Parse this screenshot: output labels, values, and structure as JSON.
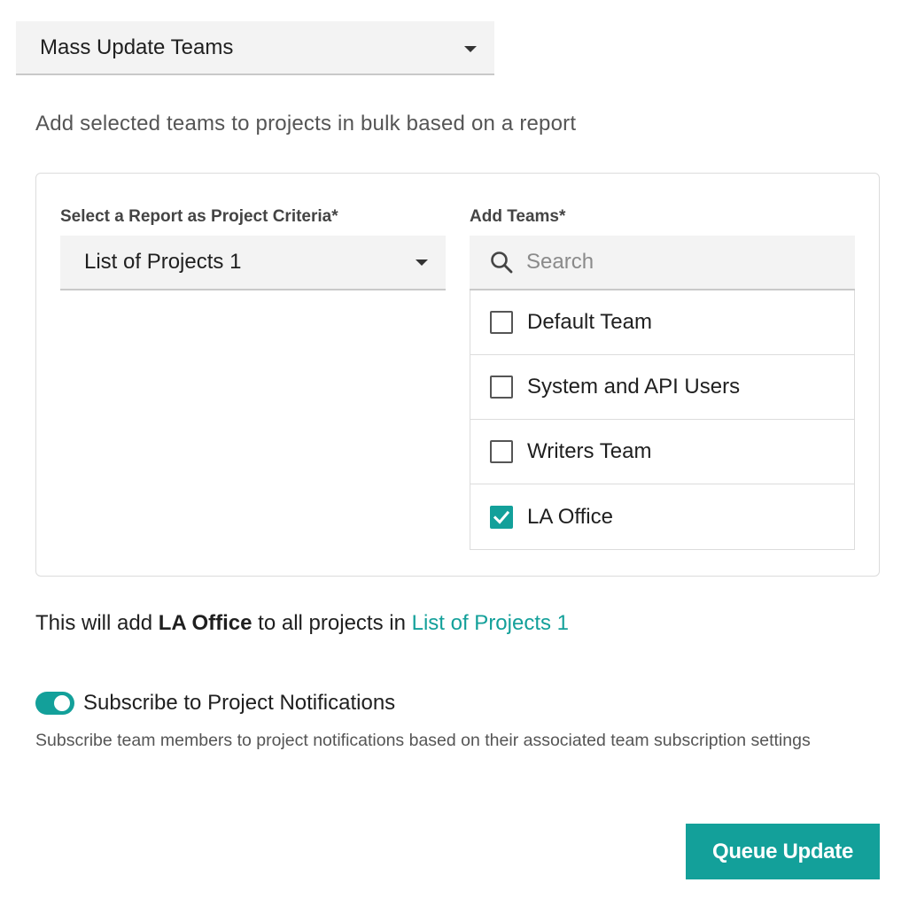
{
  "mode_select": {
    "selected": "Mass Update Teams",
    "icon": "chevron-down-icon"
  },
  "description": "Add selected teams to projects in bulk based on a report",
  "report_field": {
    "label": "Select a Report as Project Criteria*",
    "selected": "List of Projects 1"
  },
  "teams_field": {
    "label": "Add Teams*",
    "search_placeholder": "Search",
    "search_value": "",
    "items": [
      {
        "name": "Default Team",
        "checked": false
      },
      {
        "name": "System and API Users",
        "checked": false
      },
      {
        "name": "Writers Team",
        "checked": false
      },
      {
        "name": "LA Office",
        "checked": true
      }
    ]
  },
  "summary": {
    "prefix": "This will add ",
    "team": "LA Office",
    "middle": " to all projects in ",
    "report_link": "List of Projects 1"
  },
  "notifications": {
    "toggle_on": true,
    "label": "Subscribe to Project Notifications",
    "help": "Subscribe team members to project notifications based on their associated team subscription settings"
  },
  "actions": {
    "queue_label": "Queue Update"
  },
  "colors": {
    "accent": "#13a09a",
    "field_bg": "#f3f3f3"
  }
}
